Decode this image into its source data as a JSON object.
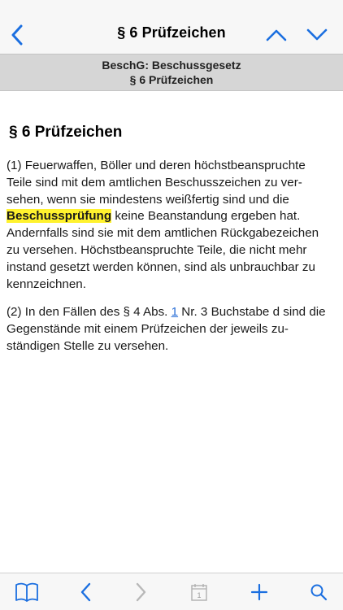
{
  "nav": {
    "title": "§ 6 Prüfzeichen",
    "icons": {
      "back": "chevron-left-icon",
      "up": "chevron-up-icon",
      "down": "chevron-down-icon"
    },
    "accent_color": "#1b6fe0"
  },
  "subheader": {
    "line1": "BeschG: Beschussgesetz",
    "line2": "§ 6 Prüfzeichen"
  },
  "article": {
    "title": "§ 6 Prüfzeichen",
    "p1": {
      "before": "(1) Feuerwaffen, Böller und deren höchstbeanspruchte Teile sind mit dem amtlichen Beschusszeichen zu ver­sehen, wenn sie mindestens weißfertig sind und die ",
      "highlight": "Beschussprüfung",
      "after": " keine Beanstandung ergeben hat. Andernfalls sind sie mit dem amtlichen Rückgabezei­chen zu versehen. Höchstbeanspruchte Teile, die nicht mehr instand gesetzt werden können, sind als un­brauchbar zu kennzeichnen."
    },
    "p2": {
      "before": "(2) In den Fällen des § 4 Abs. ",
      "link": "1",
      "after": " Nr. 3 Buchstabe d sind die Gegenstände mit einem Prüfzeichen der jeweils zu­ständigen Stelle zu versehen."
    },
    "highlight_color": "#fff22e"
  },
  "toolbar": {
    "calendar_number": "1",
    "icons": [
      "book-icon",
      "arrow-back-icon",
      "arrow-forward-icon",
      "calendar-icon",
      "plus-icon",
      "search-icon"
    ]
  }
}
